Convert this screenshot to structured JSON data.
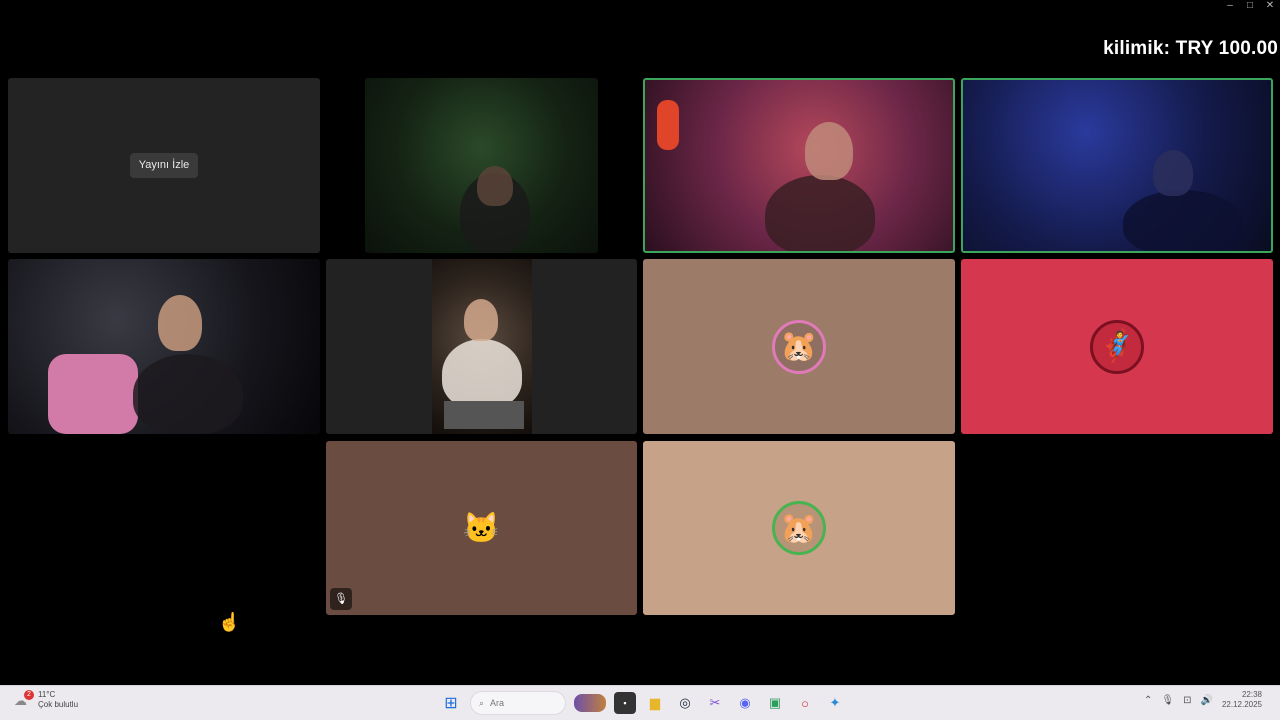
{
  "window": {
    "controls": [
      "–",
      "□",
      "✕"
    ]
  },
  "donation_overlay": "kilimik: TRY 100.00",
  "tiles": {
    "stream_tile": {
      "watch_button": "Yayını İzle"
    }
  },
  "taskbar": {
    "weather": {
      "temp": "11°C",
      "condition": "Çok bulutlu",
      "badge": "2"
    },
    "search_placeholder": "Ara",
    "clock": {
      "time": "22:38",
      "date": "22.12.2025"
    }
  },
  "colors": {
    "speaking_border": "#3ba55c",
    "tile_dark": "#232323",
    "tile_brown": "#9c7b68",
    "tile_red": "#d5374e",
    "tile_dark_brown": "#6b4c40",
    "tile_tan": "#c6a288"
  },
  "icons": {
    "muted": "microphone-muted-icon",
    "start": "windows-start-icon",
    "search": "search-icon",
    "cursor": "hand-cursor-icon"
  }
}
